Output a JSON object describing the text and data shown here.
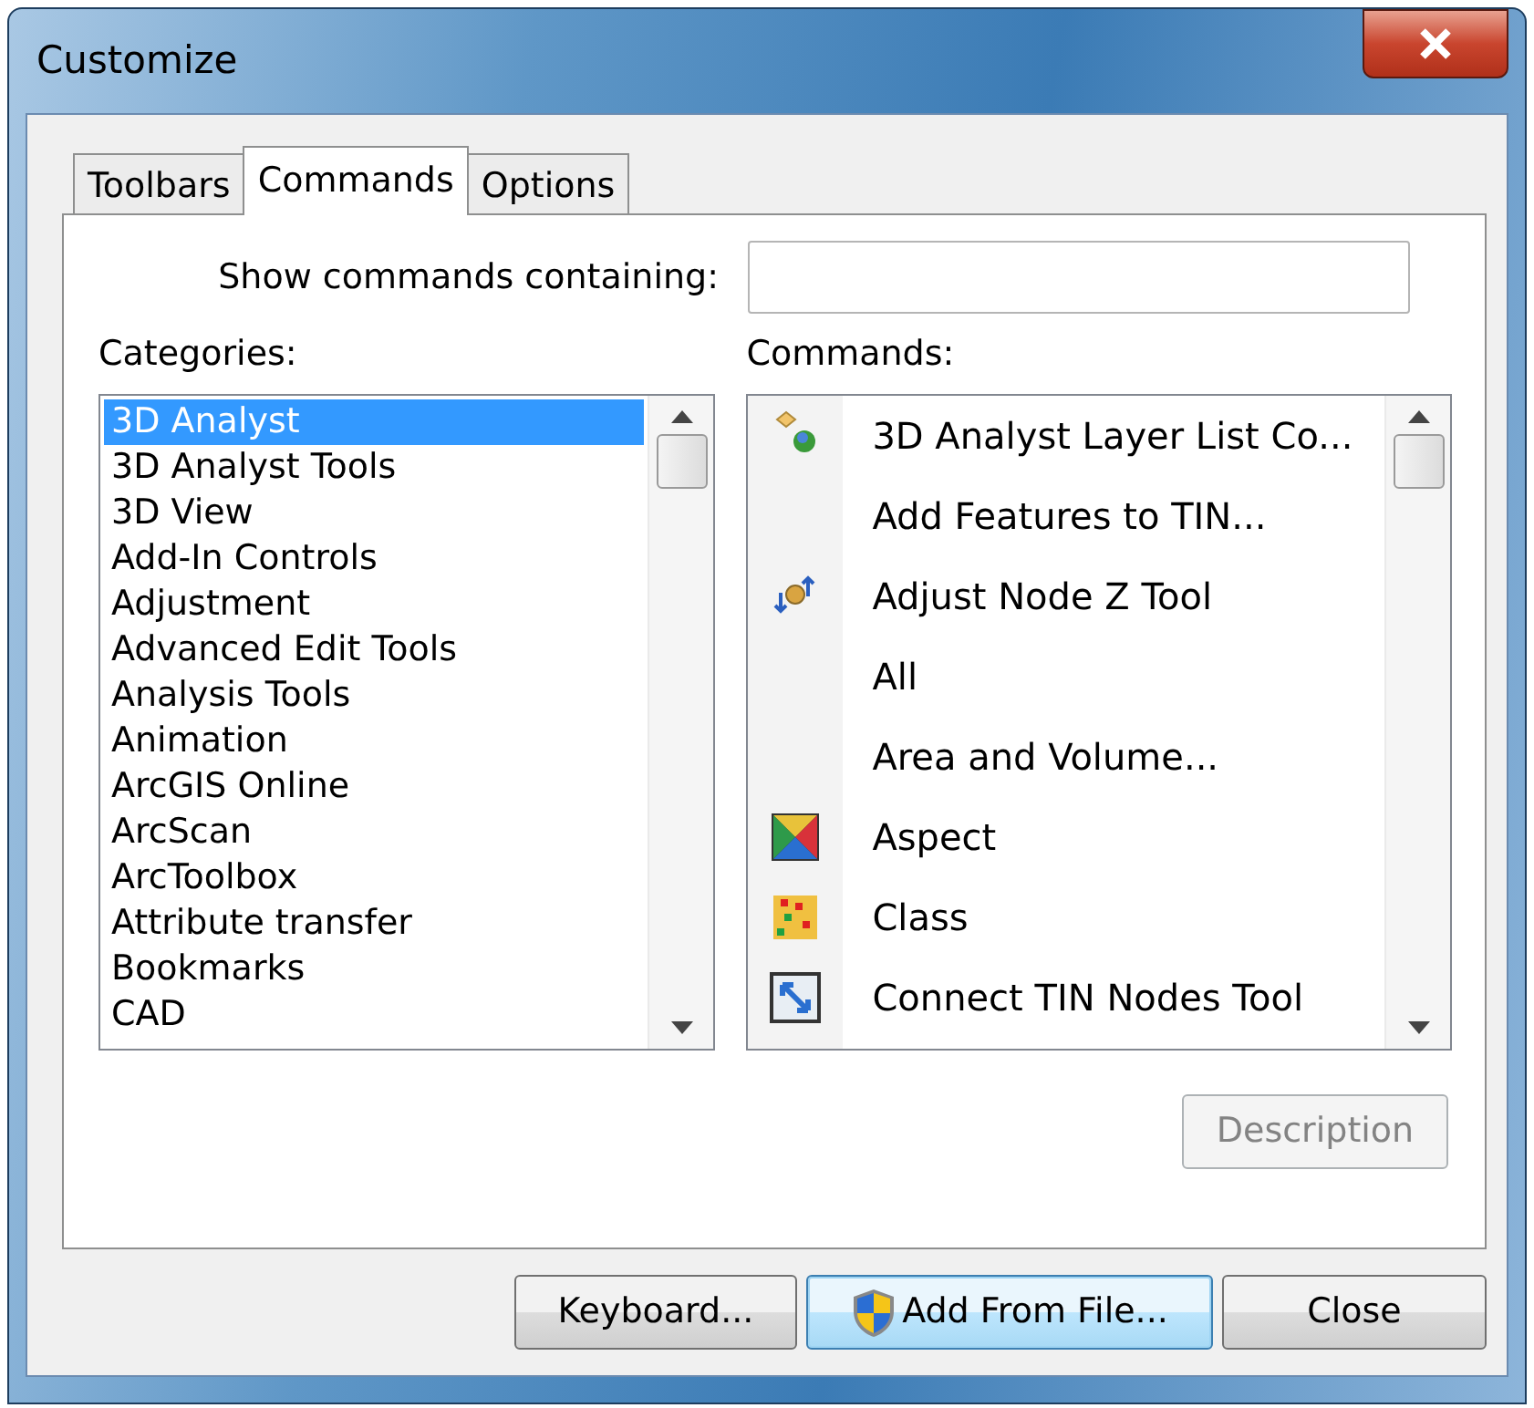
{
  "window": {
    "title": "Customize"
  },
  "tabs": [
    {
      "label": "Toolbars",
      "selected": false
    },
    {
      "label": "Commands",
      "selected": true
    },
    {
      "label": "Options",
      "selected": false
    }
  ],
  "search": {
    "label": "Show commands containing:"
  },
  "categories": {
    "label": "Categories:",
    "items": [
      {
        "label": "3D Analyst",
        "selected": true
      },
      {
        "label": "3D Analyst Tools",
        "selected": false
      },
      {
        "label": "3D View",
        "selected": false
      },
      {
        "label": "Add-In Controls",
        "selected": false
      },
      {
        "label": "Adjustment",
        "selected": false
      },
      {
        "label": "Advanced Edit Tools",
        "selected": false
      },
      {
        "label": "Analysis Tools",
        "selected": false
      },
      {
        "label": "Animation",
        "selected": false
      },
      {
        "label": "ArcGIS Online",
        "selected": false
      },
      {
        "label": "ArcScan",
        "selected": false
      },
      {
        "label": "ArcToolbox",
        "selected": false
      },
      {
        "label": "Attribute transfer",
        "selected": false
      },
      {
        "label": "Bookmarks",
        "selected": false
      },
      {
        "label": "CAD",
        "selected": false
      }
    ]
  },
  "commands": {
    "label": "Commands:",
    "items": [
      {
        "label": "3D Analyst Layer List Co...",
        "kind": "globe"
      },
      {
        "label": "Add Features to TIN...",
        "kind": "none"
      },
      {
        "label": "Adjust Node Z Tool",
        "kind": "arrows"
      },
      {
        "label": "All",
        "kind": "none"
      },
      {
        "label": "Area and Volume...",
        "kind": "none"
      },
      {
        "label": "Aspect",
        "kind": "aspect"
      },
      {
        "label": "Class",
        "kind": "grid"
      },
      {
        "label": "Connect TIN Nodes Tool",
        "kind": "connect"
      }
    ]
  },
  "description_button": {
    "label": "Description",
    "disabled": true
  },
  "buttons": [
    {
      "label": "Keyboard...",
      "kind": "plain",
      "focused": false
    },
    {
      "label": "Add From File...",
      "kind": "shield",
      "focused": true
    },
    {
      "label": "Close",
      "kind": "plain",
      "focused": false
    }
  ]
}
